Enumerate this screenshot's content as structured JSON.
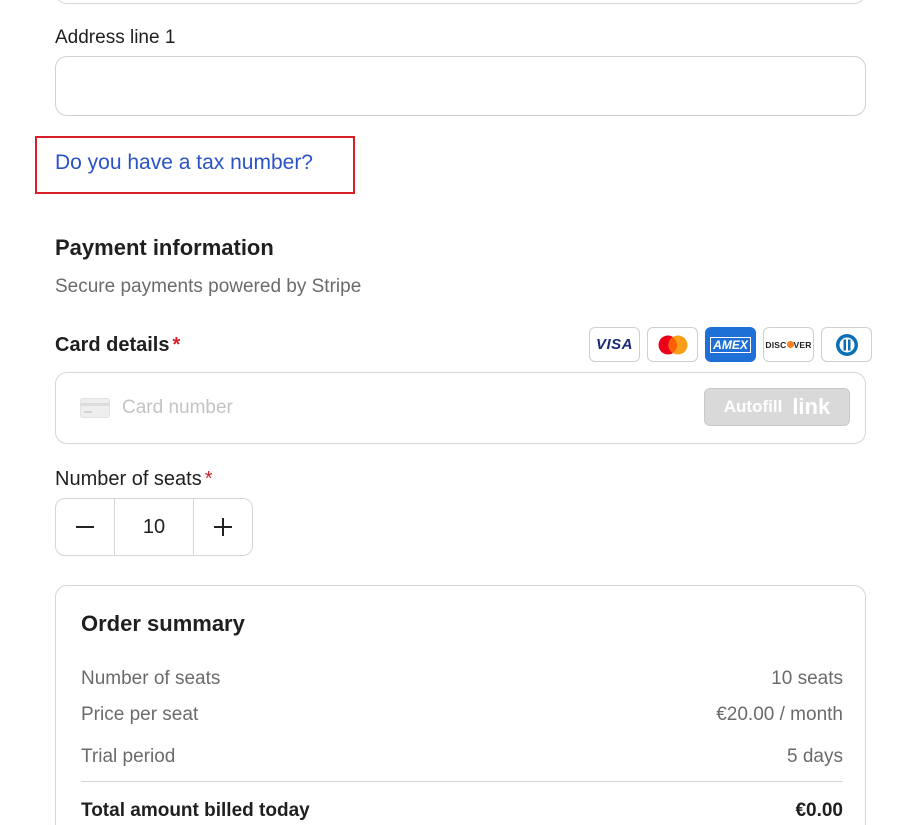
{
  "billing": {
    "address_line1_label": "Address line 1",
    "address_line1_value": "",
    "tax_link": "Do you have a tax number?"
  },
  "payment": {
    "title": "Payment information",
    "subtitle": "Secure payments powered by Stripe",
    "card_label": "Card details",
    "required_mark": "*",
    "brands": [
      "visa-icon",
      "mastercard-icon",
      "amex-icon",
      "discover-icon",
      "diners-club-icon"
    ],
    "card_brand_text": {
      "visa": "VISA",
      "amex": "AMEX",
      "discover": "DISC",
      "discover_end": "VER"
    },
    "card_placeholder": "Card number",
    "autofill_label": "Autofill",
    "autofill_link": "link"
  },
  "seats": {
    "label": "Number of seats",
    "required_mark": "*",
    "value": "10",
    "decrement": "−",
    "increment": "+"
  },
  "order_summary": {
    "title": "Order summary",
    "rows": [
      {
        "label": "Number of seats",
        "value": "10 seats"
      },
      {
        "label": "Price per seat",
        "value": "€20.00 / month"
      },
      {
        "label": "Trial period",
        "value": "5 days"
      }
    ],
    "total_label": "Total amount billed today",
    "total_value": "€0.00"
  },
  "colors": {
    "link": "#2a52c9",
    "required": "#d61f26",
    "highlight_box": "#d61f26",
    "amex_blue": "#1e6fd6"
  }
}
